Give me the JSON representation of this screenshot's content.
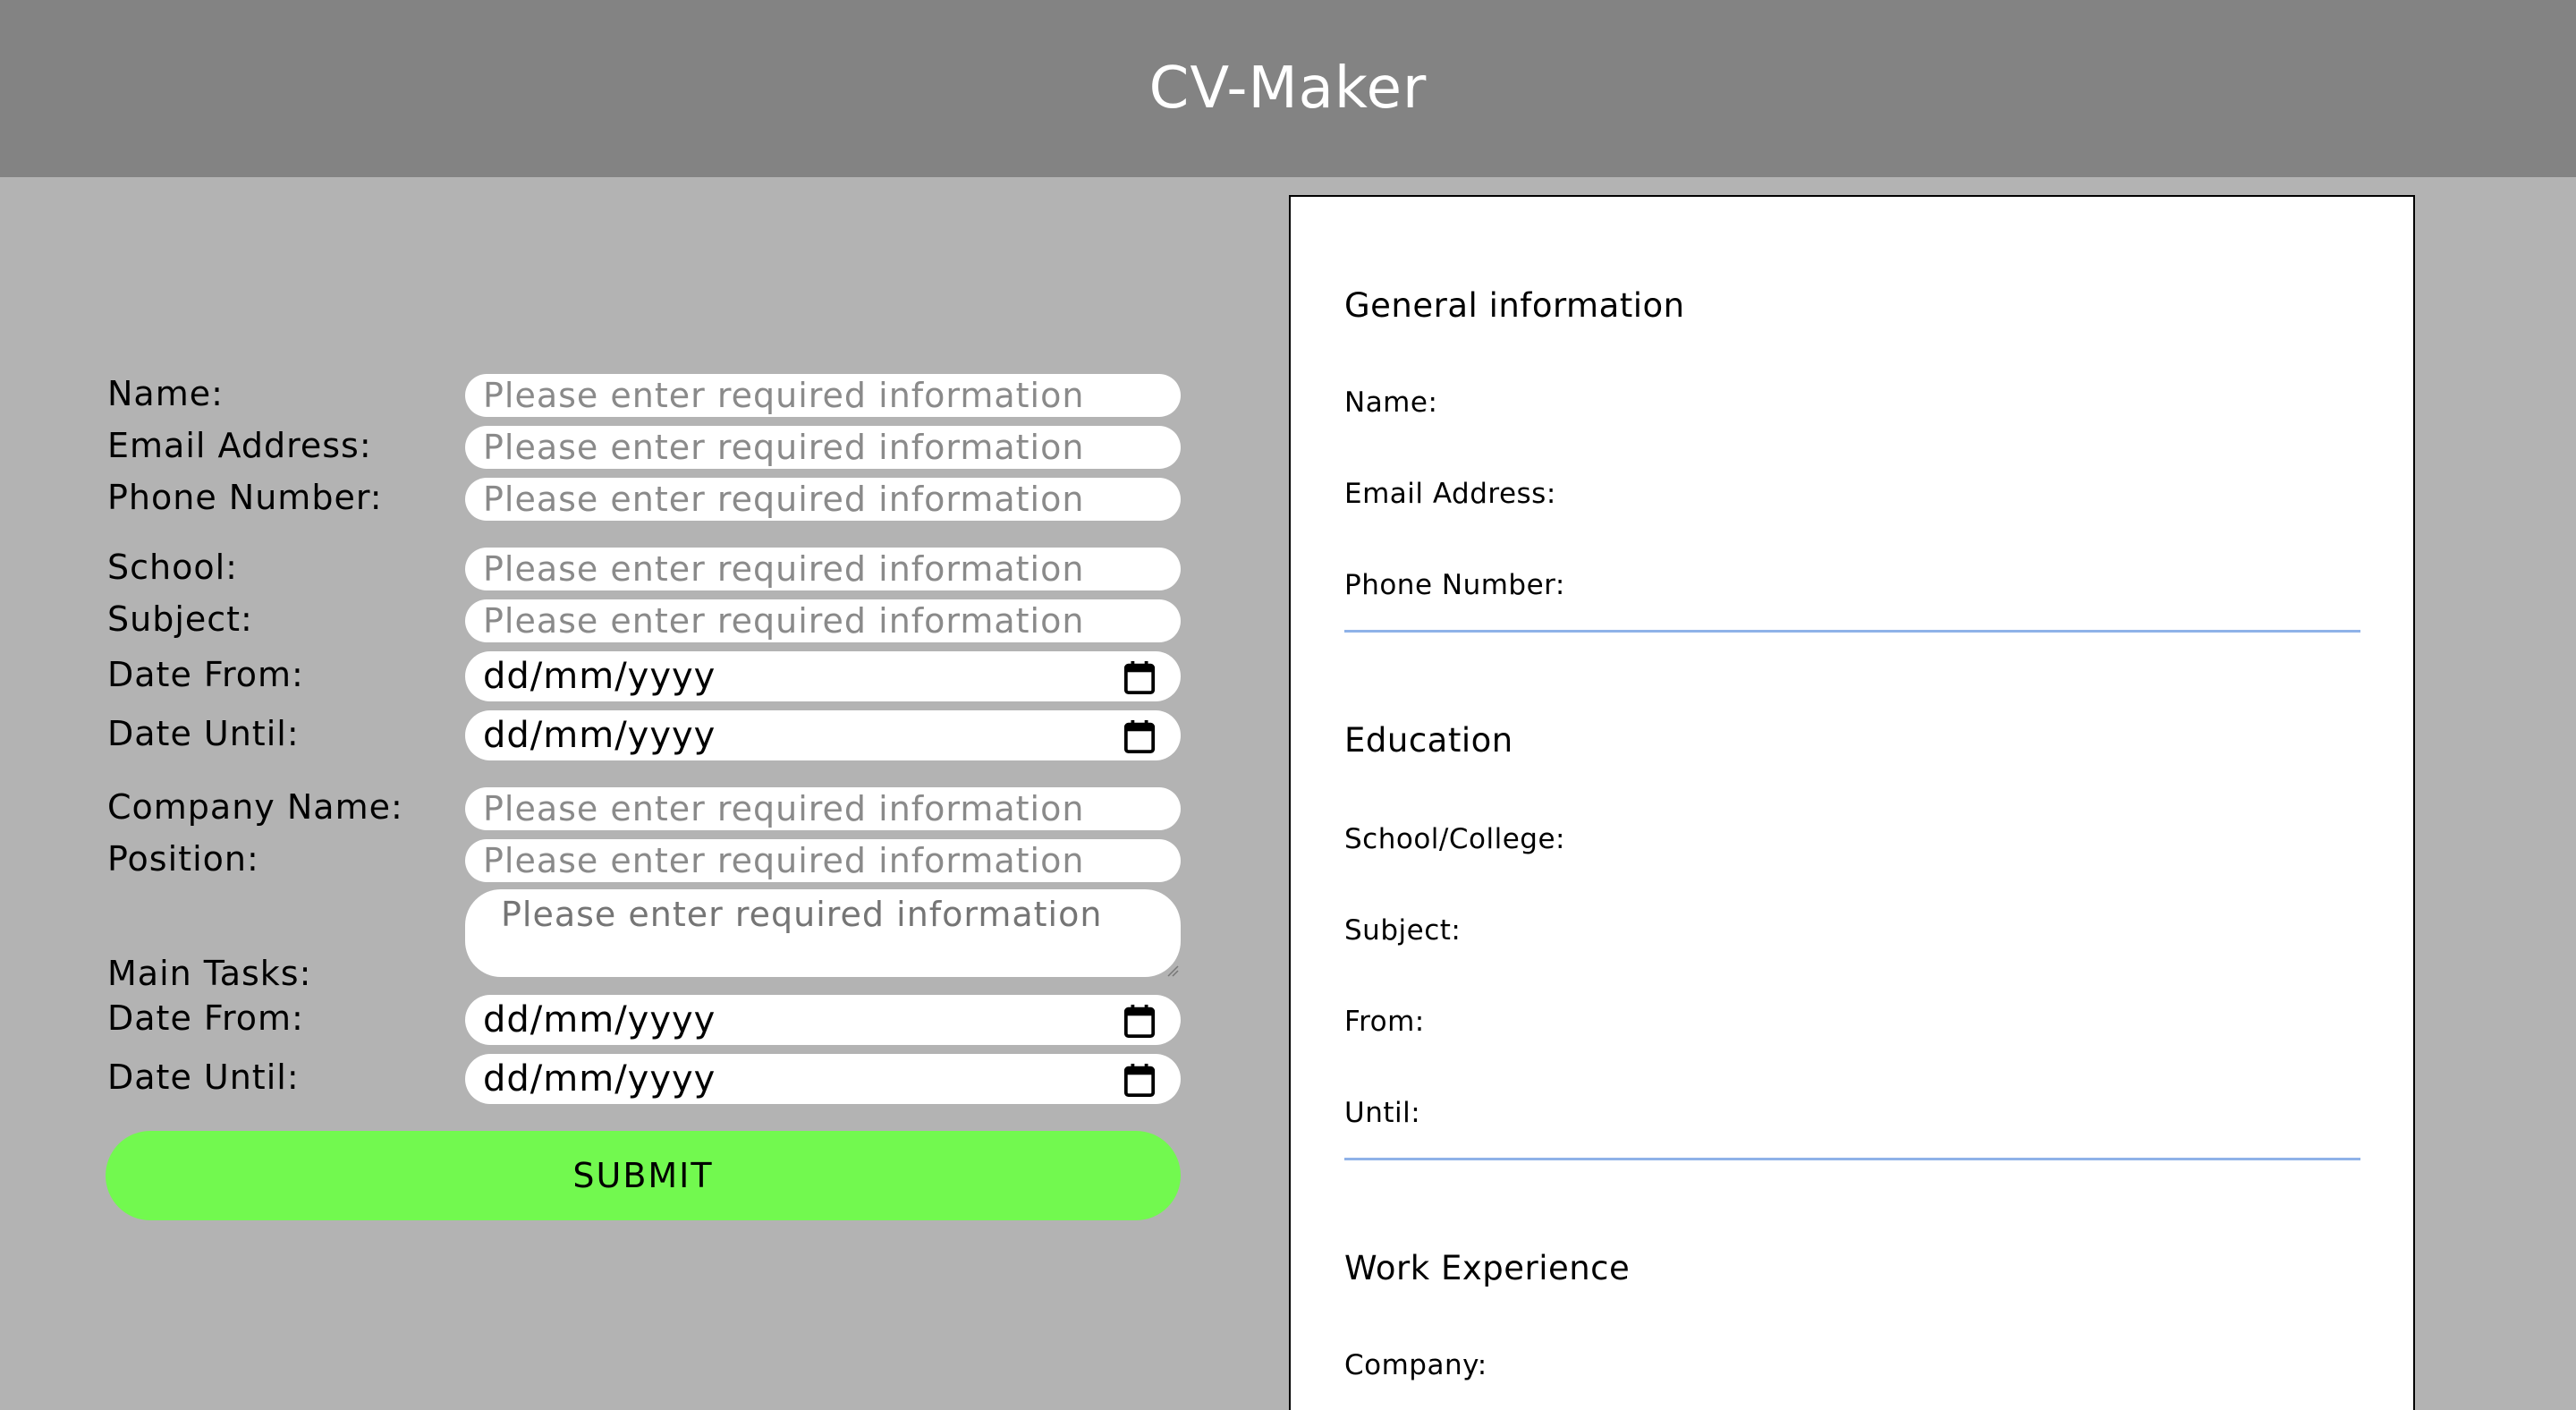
{
  "app": {
    "title": "CV-Maker"
  },
  "form": {
    "placeholder": "Please enter required information",
    "date_placeholder": "dd/mm/yyyy",
    "labels": {
      "name": "Name:",
      "email": "Email Address:",
      "phone": "Phone Number:",
      "school": "School:",
      "subject": "Subject:",
      "edu_from": "Date From:",
      "edu_until": "Date Until:",
      "company": "Company Name:",
      "position": "Position:",
      "tasks": "Main Tasks:",
      "work_from": "Date From:",
      "work_until": "Date Until:"
    },
    "submit_label": "SUBMIT"
  },
  "preview": {
    "general": {
      "heading": "General information",
      "name": "Name:",
      "email": "Email Address:",
      "phone": "Phone Number:"
    },
    "education": {
      "heading": "Education",
      "school": "School/College:",
      "subject": "Subject:",
      "from": "From:",
      "until": "Until:"
    },
    "work": {
      "heading": "Work Experience",
      "company": "Company:"
    }
  },
  "colors": {
    "header_bg": "#838383",
    "page_bg": "#b3b3b3",
    "submit_bg": "#72f94f",
    "divider": "#8fb2e8"
  }
}
